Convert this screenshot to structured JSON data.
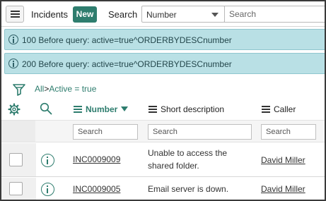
{
  "header": {
    "title": "Incidents",
    "new_label": "New",
    "search_label": "Search",
    "field_select_value": "Number",
    "search_placeholder": "Search"
  },
  "messages": [
    "100 Before query: active=true^ORDERBYDESCnumber",
    "200 Before query: active=true^ORDERBYDESCnumber"
  ],
  "breadcrumb": {
    "all": "All",
    "separator": ">",
    "condition": "Active = true"
  },
  "columns": [
    {
      "label": "Number",
      "sorted": "descending"
    },
    {
      "label": "Short description"
    },
    {
      "label": "Caller"
    }
  ],
  "column_search_placeholder": "Search",
  "rows": [
    {
      "number": "INC0009009",
      "short_description": "Unable to access the shared folder.",
      "caller": "David Miller"
    },
    {
      "number": "INC0009005",
      "short_description": "Email server is down.",
      "caller": "David Miller"
    }
  ],
  "colors": {
    "accent": "#2e7d6e",
    "info_banner": "#b9e0e5"
  },
  "icons": [
    "menu-icon",
    "info-icon",
    "filter-funnel-icon",
    "gear-icon",
    "magnifier-icon",
    "sort-descending-icon"
  ]
}
